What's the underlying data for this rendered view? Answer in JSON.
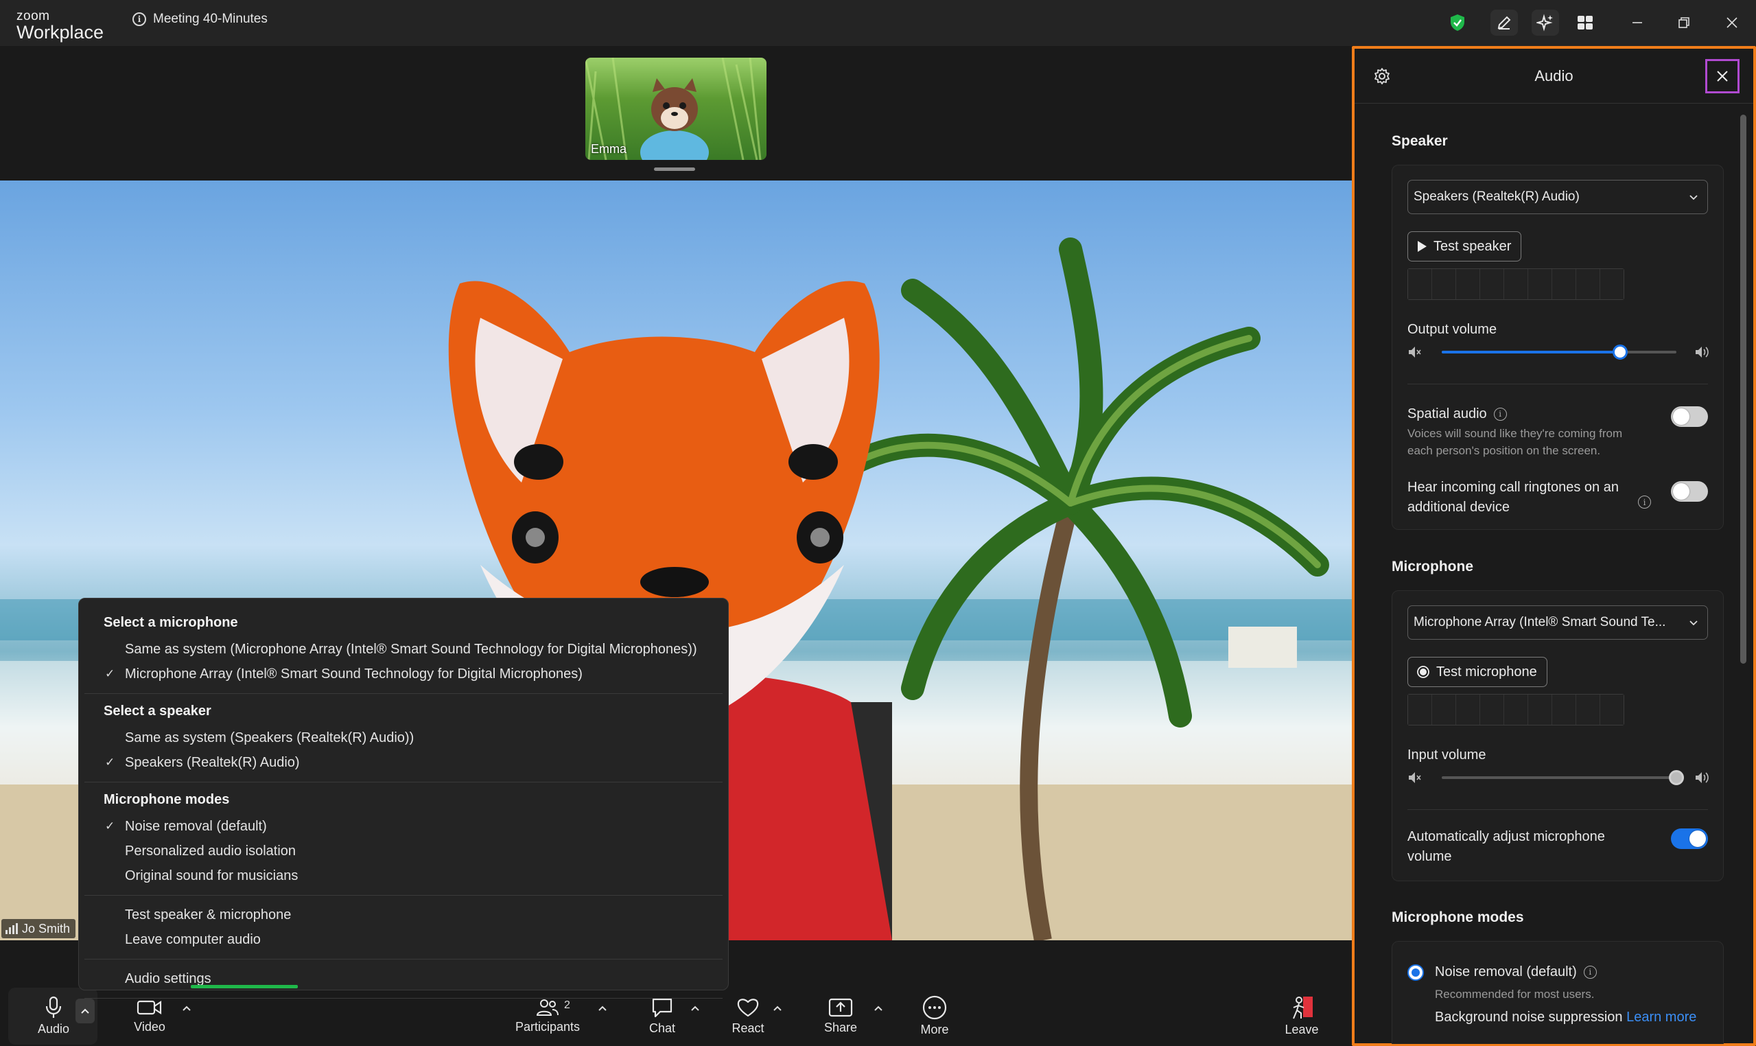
{
  "app": {
    "logo_top": "zoom",
    "logo_bottom": "Workplace",
    "meeting_title": "Meeting 40-Minutes"
  },
  "participants": {
    "thumb_name": "Emma",
    "main_name": "Jo Smith"
  },
  "toolbar": {
    "audio": "Audio",
    "video": "Video",
    "participants": "Participants",
    "participants_count": "2",
    "chat": "Chat",
    "react": "React",
    "share": "Share",
    "more": "More",
    "leave": "Leave"
  },
  "audio_menu": {
    "mic_heading": "Select a microphone",
    "mic_options": [
      "Same as system (Microphone Array (Intel® Smart Sound Technology for Digital Microphones))",
      "Microphone Array (Intel® Smart Sound Technology for Digital Microphones)"
    ],
    "speaker_heading": "Select a speaker",
    "speaker_options": [
      "Same as system (Speakers (Realtek(R) Audio))",
      "Speakers (Realtek(R) Audio)"
    ],
    "modes_heading": "Microphone modes",
    "mode_options": [
      "Noise removal (default)",
      "Personalized audio isolation",
      "Original sound for musicians"
    ],
    "test": "Test speaker & microphone",
    "leave_audio": "Leave computer audio",
    "settings": "Audio settings",
    "check_glyph": "✓"
  },
  "audio_panel": {
    "title": "Audio",
    "speaker": {
      "section": "Speaker",
      "device": "Speakers (Realtek(R) Audio)",
      "test_button": "Test speaker",
      "output_label": "Output volume",
      "output_level": 0.76,
      "spatial_label": "Spatial audio",
      "spatial_on": false,
      "spatial_desc_1": "Voices will sound like they're coming from",
      "spatial_desc_2": "each person's position on the screen.",
      "ringtone_label_1": "Hear incoming call ringtones on an",
      "ringtone_label_2": "additional device",
      "ringtone_on": false
    },
    "microphone": {
      "section": "Microphone",
      "device": "Microphone Array (Intel® Smart Sound Te...",
      "test_button": "Test microphone",
      "input_label": "Input volume",
      "input_level": 1.0,
      "auto_label_1": "Automatically adjust microphone",
      "auto_label_2": "volume",
      "auto_on": true
    },
    "modes": {
      "section": "Microphone modes",
      "noise_label": "Noise removal (default)",
      "noise_desc": "Recommended for most users.",
      "bg_label": "Background noise suppression",
      "learn_more": "Learn more"
    }
  },
  "colors": {
    "accent": "#1a73e8",
    "panel_border": "#f07d1a",
    "close_highlight": "#b04ad0",
    "menu_underline": "#1fb84a",
    "leave_red": "#e0323c",
    "shield_green": "#1fb84a"
  }
}
